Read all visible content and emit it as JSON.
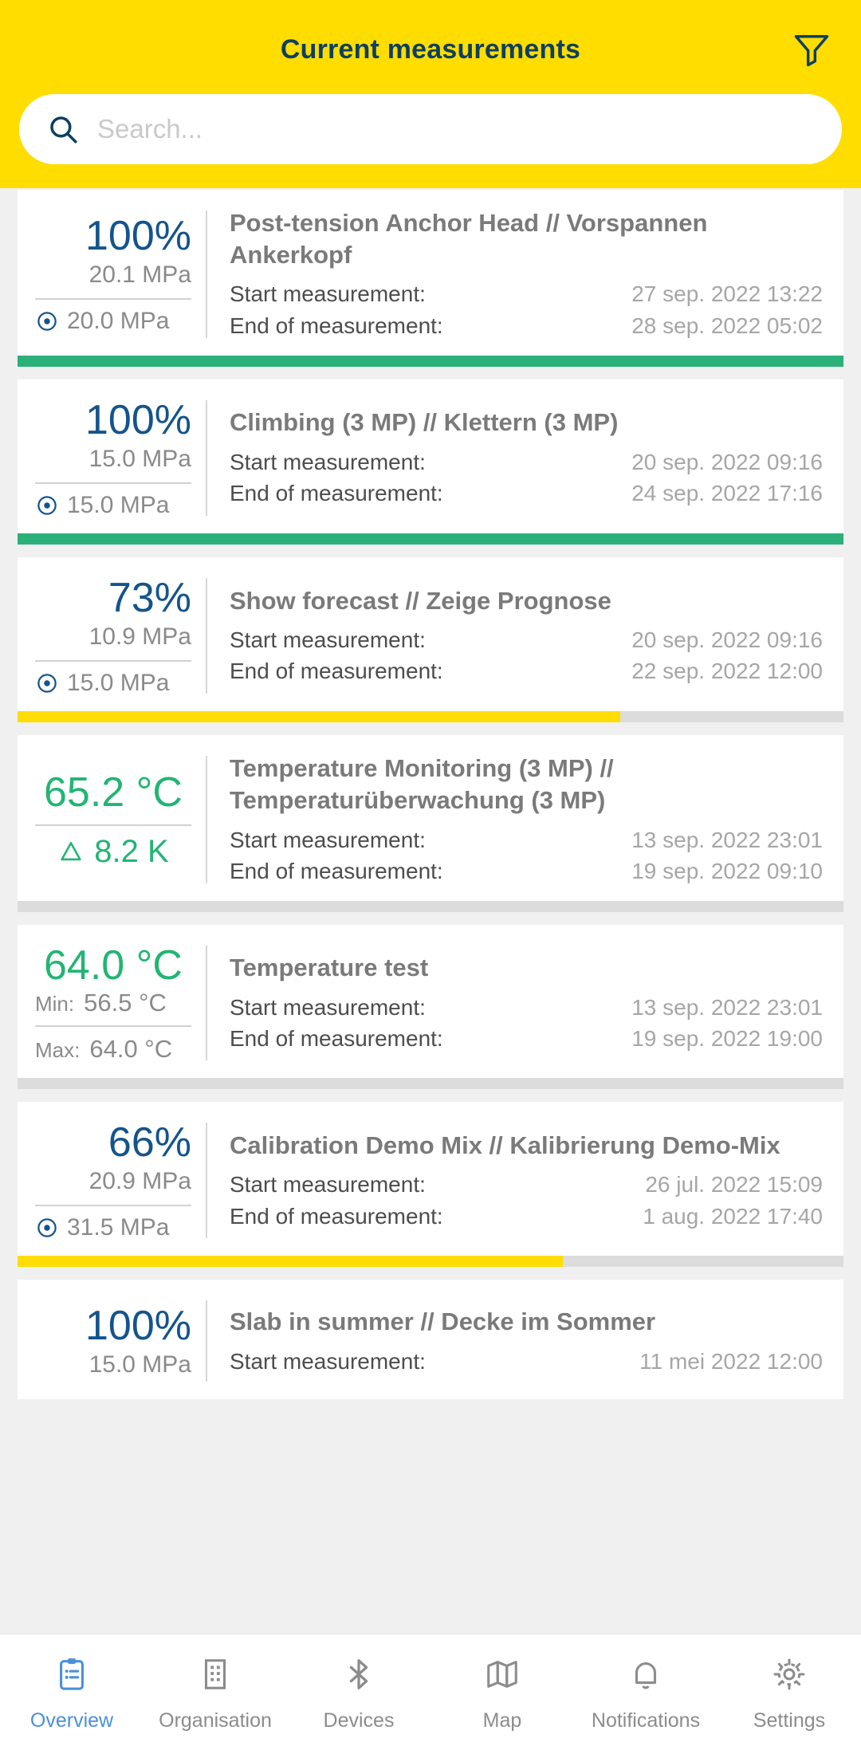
{
  "header": {
    "title": "Current measurements",
    "filter_icon": "filter-funnel-icon",
    "search": {
      "placeholder": "Search...",
      "value": "",
      "icon": "search-icon"
    },
    "background_color": "#ffdd00",
    "title_color": "#0d3f62"
  },
  "colors": {
    "accent_yellow": "#ffdd00",
    "progress_green": "#2bb07a",
    "progress_yellow": "#ffdd00",
    "progress_track": "#dcdcdc",
    "value_blue": "#14548c",
    "value_green": "#22b573",
    "nav_active": "#4a90d9"
  },
  "labels": {
    "start": "Start measurement:",
    "end": "End of measurement:",
    "min": "Min:",
    "max": "Max:"
  },
  "cards": [
    {
      "primary": "100%",
      "primary_kind": "percent",
      "sub": "20.1 MPa",
      "bottom": "20.0 MPa",
      "bottom_icon": "target-icon",
      "title": "Post-tension Anchor Head // Vorspannen Ankerkopf",
      "start": "27 sep. 2022 13:22",
      "end": "28 sep. 2022 05:02",
      "progress": 100,
      "progress_color": "#2bb07a"
    },
    {
      "primary": "100%",
      "primary_kind": "percent",
      "sub": "15.0 MPa",
      "bottom": "15.0 MPa",
      "bottom_icon": "target-icon",
      "title": "Climbing (3 MP) // Klettern (3 MP)",
      "start": "20 sep. 2022 09:16",
      "end": "24 sep. 2022 17:16",
      "progress": 100,
      "progress_color": "#2bb07a"
    },
    {
      "primary": "73%",
      "primary_kind": "percent",
      "sub": "10.9 MPa",
      "bottom": "15.0 MPa",
      "bottom_icon": "target-icon",
      "title": "Show forecast // Zeige Prognose",
      "start": "20 sep. 2022 09:16",
      "end": "22 sep. 2022 12:00",
      "progress": 73,
      "progress_color": "#ffdd00"
    },
    {
      "primary": "65.2 °C",
      "primary_kind": "temperature",
      "bottom": "8.2 K",
      "bottom_icon": "delta-triangle-icon",
      "title": "Temperature Monitoring (3 MP) // Temperaturüberwachung (3 MP)",
      "start": "13 sep. 2022 23:01",
      "end": "19 sep. 2022 09:10",
      "progress": 0,
      "progress_color": "#dcdcdc"
    },
    {
      "primary": "64.0 °C",
      "primary_kind": "temperature-minmax",
      "min": "56.5 °C",
      "max": "64.0 °C",
      "title": "Temperature test",
      "start": "13 sep. 2022 23:01",
      "end": "19 sep. 2022 19:00",
      "progress": 0,
      "progress_color": "#dcdcdc"
    },
    {
      "primary": "66%",
      "primary_kind": "percent",
      "sub": "20.9 MPa",
      "bottom": "31.5 MPa",
      "bottom_icon": "target-icon",
      "title": "Calibration Demo Mix // Kalibrierung Demo-Mix",
      "start": "26 jul. 2022 15:09",
      "end": "1 aug. 2022 17:40",
      "progress": 66,
      "progress_color": "#ffdd00"
    },
    {
      "primary": "100%",
      "primary_kind": "percent",
      "sub": "15.0 MPa",
      "title": "Slab in summer // Decke im Sommer",
      "start": "11 mei 2022 12:00"
    }
  ],
  "bottomnav": {
    "items": [
      {
        "label": "Overview",
        "icon": "clipboard-list-icon",
        "active": true
      },
      {
        "label": "Organisation",
        "icon": "building-icon",
        "active": false
      },
      {
        "label": "Devices",
        "icon": "bluetooth-icon",
        "active": false
      },
      {
        "label": "Map",
        "icon": "map-icon",
        "active": false
      },
      {
        "label": "Notifications",
        "icon": "bell-icon",
        "active": false
      },
      {
        "label": "Settings",
        "icon": "gear-icon",
        "active": false
      }
    ]
  }
}
